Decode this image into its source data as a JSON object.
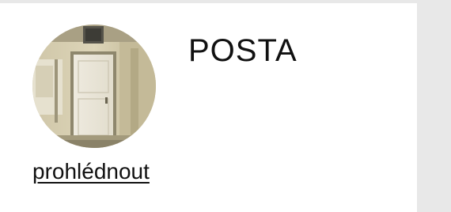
{
  "card": {
    "title": "POSTA",
    "link_label": "prohlédnout",
    "image_subject": "door-photo"
  },
  "colors": {
    "page_background": "#e8e8e8",
    "card_background": "#ffffff",
    "text": "#111111"
  }
}
